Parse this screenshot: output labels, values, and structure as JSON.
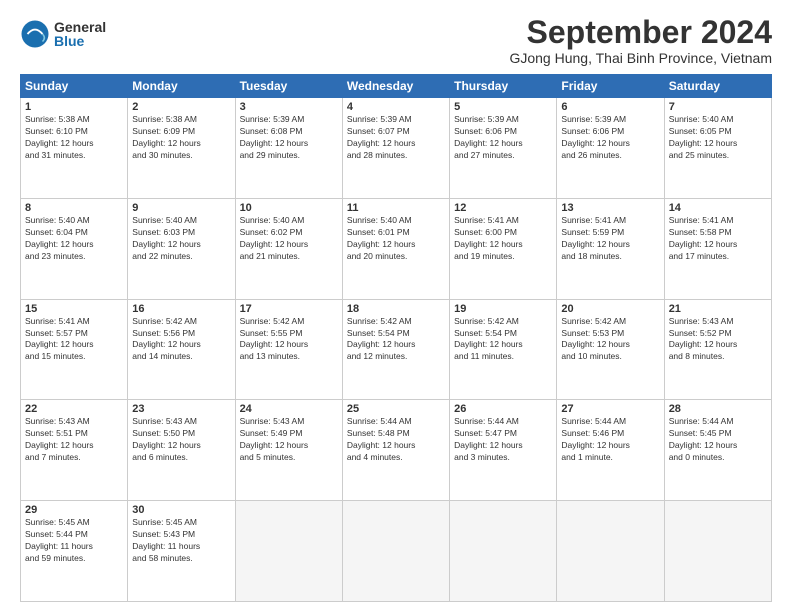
{
  "logo": {
    "general": "General",
    "blue": "Blue"
  },
  "title": "September 2024",
  "location": "GJong Hung, Thai Binh Province, Vietnam",
  "days_of_week": [
    "Sunday",
    "Monday",
    "Tuesday",
    "Wednesday",
    "Thursday",
    "Friday",
    "Saturday"
  ],
  "weeks": [
    [
      {
        "day": "1",
        "info": "Sunrise: 5:38 AM\nSunset: 6:10 PM\nDaylight: 12 hours\nand 31 minutes."
      },
      {
        "day": "2",
        "info": "Sunrise: 5:38 AM\nSunset: 6:09 PM\nDaylight: 12 hours\nand 30 minutes."
      },
      {
        "day": "3",
        "info": "Sunrise: 5:39 AM\nSunset: 6:08 PM\nDaylight: 12 hours\nand 29 minutes."
      },
      {
        "day": "4",
        "info": "Sunrise: 5:39 AM\nSunset: 6:07 PM\nDaylight: 12 hours\nand 28 minutes."
      },
      {
        "day": "5",
        "info": "Sunrise: 5:39 AM\nSunset: 6:06 PM\nDaylight: 12 hours\nand 27 minutes."
      },
      {
        "day": "6",
        "info": "Sunrise: 5:39 AM\nSunset: 6:06 PM\nDaylight: 12 hours\nand 26 minutes."
      },
      {
        "day": "7",
        "info": "Sunrise: 5:40 AM\nSunset: 6:05 PM\nDaylight: 12 hours\nand 25 minutes."
      }
    ],
    [
      {
        "day": "8",
        "info": "Sunrise: 5:40 AM\nSunset: 6:04 PM\nDaylight: 12 hours\nand 23 minutes."
      },
      {
        "day": "9",
        "info": "Sunrise: 5:40 AM\nSunset: 6:03 PM\nDaylight: 12 hours\nand 22 minutes."
      },
      {
        "day": "10",
        "info": "Sunrise: 5:40 AM\nSunset: 6:02 PM\nDaylight: 12 hours\nand 21 minutes."
      },
      {
        "day": "11",
        "info": "Sunrise: 5:40 AM\nSunset: 6:01 PM\nDaylight: 12 hours\nand 20 minutes."
      },
      {
        "day": "12",
        "info": "Sunrise: 5:41 AM\nSunset: 6:00 PM\nDaylight: 12 hours\nand 19 minutes."
      },
      {
        "day": "13",
        "info": "Sunrise: 5:41 AM\nSunset: 5:59 PM\nDaylight: 12 hours\nand 18 minutes."
      },
      {
        "day": "14",
        "info": "Sunrise: 5:41 AM\nSunset: 5:58 PM\nDaylight: 12 hours\nand 17 minutes."
      }
    ],
    [
      {
        "day": "15",
        "info": "Sunrise: 5:41 AM\nSunset: 5:57 PM\nDaylight: 12 hours\nand 15 minutes."
      },
      {
        "day": "16",
        "info": "Sunrise: 5:42 AM\nSunset: 5:56 PM\nDaylight: 12 hours\nand 14 minutes."
      },
      {
        "day": "17",
        "info": "Sunrise: 5:42 AM\nSunset: 5:55 PM\nDaylight: 12 hours\nand 13 minutes."
      },
      {
        "day": "18",
        "info": "Sunrise: 5:42 AM\nSunset: 5:54 PM\nDaylight: 12 hours\nand 12 minutes."
      },
      {
        "day": "19",
        "info": "Sunrise: 5:42 AM\nSunset: 5:54 PM\nDaylight: 12 hours\nand 11 minutes."
      },
      {
        "day": "20",
        "info": "Sunrise: 5:42 AM\nSunset: 5:53 PM\nDaylight: 12 hours\nand 10 minutes."
      },
      {
        "day": "21",
        "info": "Sunrise: 5:43 AM\nSunset: 5:52 PM\nDaylight: 12 hours\nand 8 minutes."
      }
    ],
    [
      {
        "day": "22",
        "info": "Sunrise: 5:43 AM\nSunset: 5:51 PM\nDaylight: 12 hours\nand 7 minutes."
      },
      {
        "day": "23",
        "info": "Sunrise: 5:43 AM\nSunset: 5:50 PM\nDaylight: 12 hours\nand 6 minutes."
      },
      {
        "day": "24",
        "info": "Sunrise: 5:43 AM\nSunset: 5:49 PM\nDaylight: 12 hours\nand 5 minutes."
      },
      {
        "day": "25",
        "info": "Sunrise: 5:44 AM\nSunset: 5:48 PM\nDaylight: 12 hours\nand 4 minutes."
      },
      {
        "day": "26",
        "info": "Sunrise: 5:44 AM\nSunset: 5:47 PM\nDaylight: 12 hours\nand 3 minutes."
      },
      {
        "day": "27",
        "info": "Sunrise: 5:44 AM\nSunset: 5:46 PM\nDaylight: 12 hours\nand 1 minute."
      },
      {
        "day": "28",
        "info": "Sunrise: 5:44 AM\nSunset: 5:45 PM\nDaylight: 12 hours\nand 0 minutes."
      }
    ],
    [
      {
        "day": "29",
        "info": "Sunrise: 5:45 AM\nSunset: 5:44 PM\nDaylight: 11 hours\nand 59 minutes."
      },
      {
        "day": "30",
        "info": "Sunrise: 5:45 AM\nSunset: 5:43 PM\nDaylight: 11 hours\nand 58 minutes."
      },
      {
        "day": "",
        "info": ""
      },
      {
        "day": "",
        "info": ""
      },
      {
        "day": "",
        "info": ""
      },
      {
        "day": "",
        "info": ""
      },
      {
        "day": "",
        "info": ""
      }
    ]
  ]
}
